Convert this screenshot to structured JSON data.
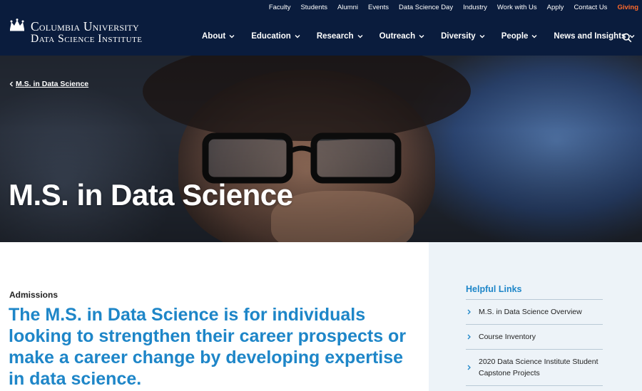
{
  "header": {
    "logo_line1": "Columbia University",
    "logo_line2": "Data Science Institute",
    "utility_links": [
      "Faculty",
      "Students",
      "Alumni",
      "Events",
      "Data Science Day",
      "Industry",
      "Work with Us",
      "Apply",
      "Contact Us",
      "Giving"
    ],
    "nav": [
      "About",
      "Education",
      "Research",
      "Outreach",
      "Diversity",
      "People",
      "News and Insights"
    ],
    "search_icon": "search-icon",
    "accent_color": "#ff6a2b",
    "background_color": "#0a1c3d"
  },
  "hero": {
    "breadcrumb": "M.S. in Data Science",
    "title": "M.S. in Data Science"
  },
  "main": {
    "eyebrow": "Admissions",
    "lead": "The M.S. in Data Science is for individuals looking to strengthen their career prospects or make a career change by developing expertise in data science."
  },
  "sidebar": {
    "title": "Helpful Links",
    "links": [
      "M.S. in Data Science Overview",
      "Course Inventory",
      "2020 Data Science Institute Student Capstone Projects"
    ],
    "link_color": "#1e86c8"
  }
}
